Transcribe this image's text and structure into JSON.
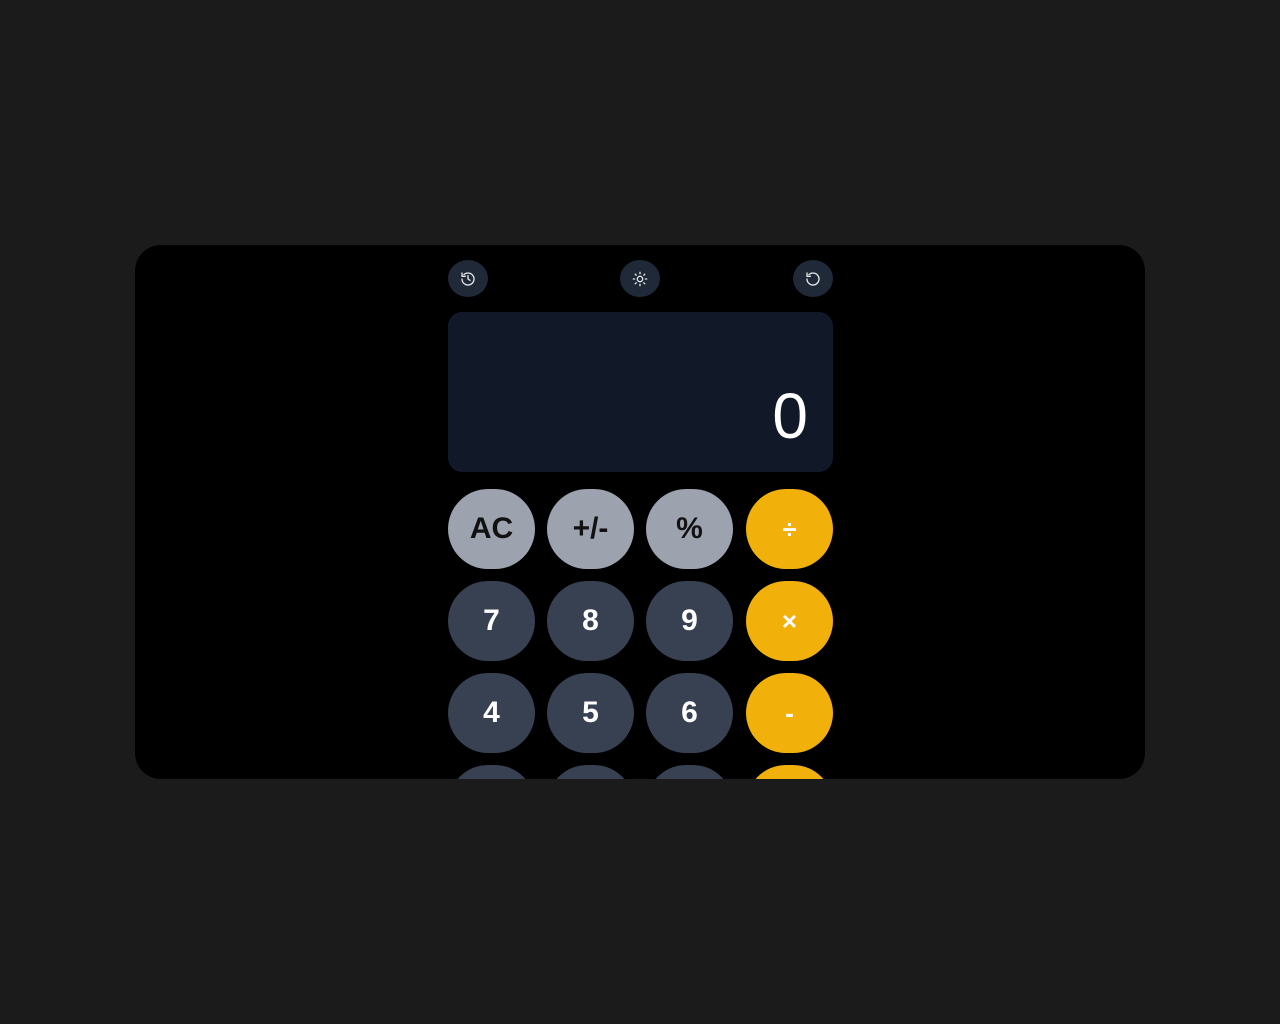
{
  "toolbar": {
    "history_icon": "history-icon",
    "theme_icon": "sun-icon",
    "reset_icon": "rotate-ccw-icon"
  },
  "display": {
    "value": "0"
  },
  "keys": {
    "row1": [
      "AC",
      "+/-",
      "%",
      "÷"
    ],
    "row2": [
      "7",
      "8",
      "9",
      "×"
    ],
    "row3": [
      "4",
      "5",
      "6",
      "-"
    ]
  },
  "colors": {
    "function_key": "#9ca3af",
    "number_key": "#374151",
    "operator_key": "#f2b10a",
    "display_bg": "#111827",
    "window_bg": "#000000",
    "page_bg": "#1b1b1b"
  }
}
